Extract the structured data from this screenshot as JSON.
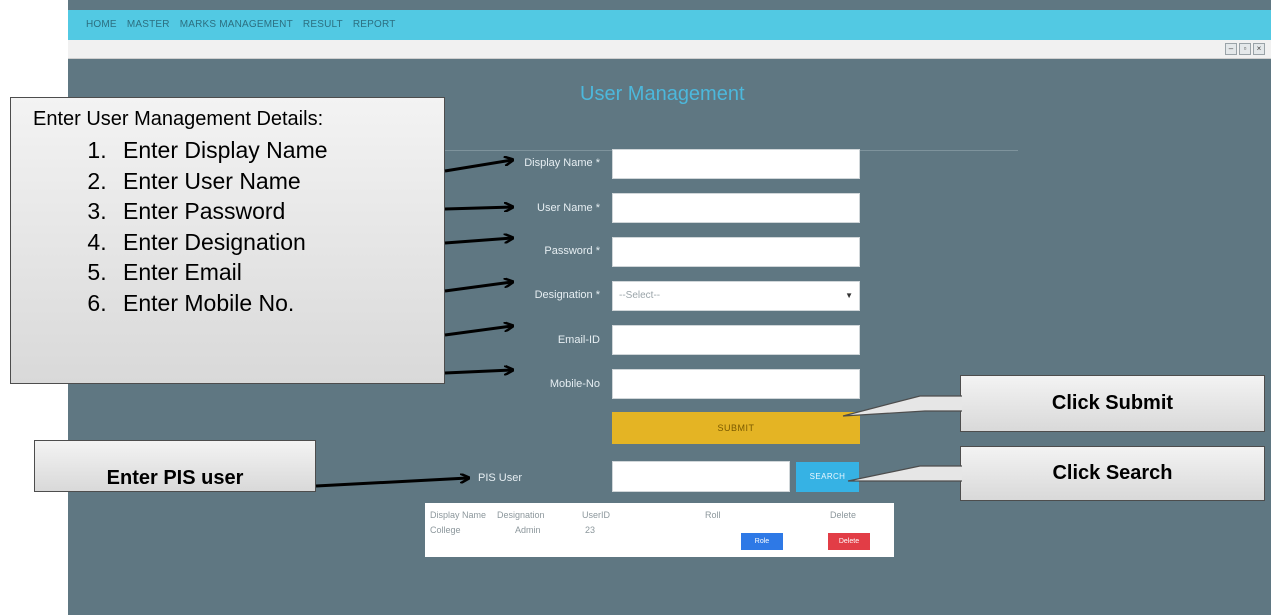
{
  "nav": {
    "items": [
      "HOME",
      "MASTER",
      "MARKS MANAGEMENT",
      "RESULT",
      "REPORT"
    ]
  },
  "page": {
    "title": "User Management"
  },
  "form": {
    "display_name_label": "Display Name *",
    "user_name_label": "User Name *",
    "password_label": "Password *",
    "designation_label": "Designation *",
    "designation_selected": "--Select--",
    "email_label": "Email-ID",
    "mobile_label": "Mobile-No",
    "submit_label": "SUBMIT"
  },
  "pis": {
    "label": "PIS User",
    "search_label": "SEARCH"
  },
  "table": {
    "headers": [
      "Display Name",
      "Designation",
      "UserID",
      "Roll",
      "Delete"
    ],
    "rows": [
      {
        "display_name": "College",
        "designation": "Admin",
        "user_id": "23",
        "role_label": "Role",
        "delete_label": "Delete"
      }
    ]
  },
  "callouts": {
    "instructions_heading": "Enter User Management Details:",
    "steps": [
      "Enter Display Name",
      "Enter User Name",
      "Enter Password",
      "Enter Designation",
      "Enter Email",
      "Enter Mobile No."
    ],
    "pis": "Enter PIS user",
    "submit": "Click Submit",
    "search": "Click Search"
  },
  "colors": {
    "nav_bar": "#52c9e3",
    "background": "#5f7782",
    "title": "#4cb8dc",
    "submit": "#e4b424",
    "search": "#36b2e4",
    "role_button": "#2e79e6",
    "delete_button": "#e23d46"
  }
}
